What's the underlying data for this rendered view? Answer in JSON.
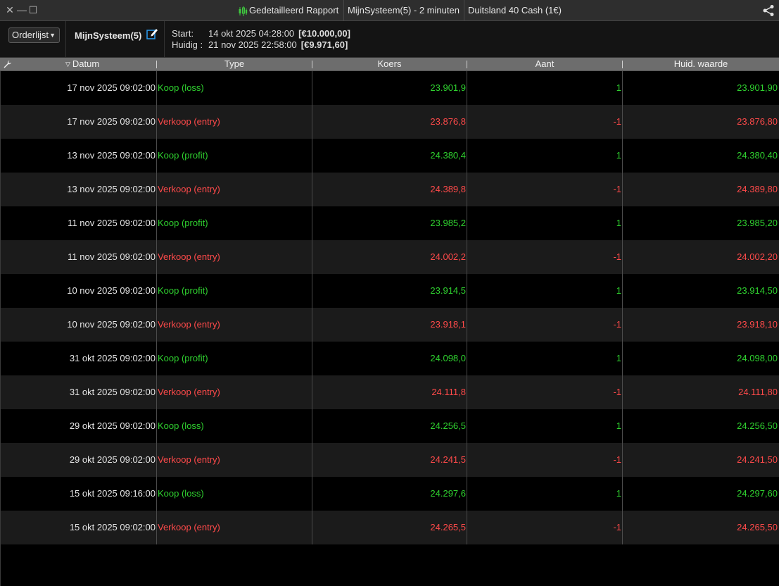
{
  "titlebar": {
    "report_label": "Gedetailleerd Rapport",
    "system_label": "MijnSysteem(5) - 2 minuten",
    "instrument_label": "Duitsland 40 Cash (1€)",
    "close_glyph": "✕",
    "minimize_glyph": "—",
    "maximize_glyph": "☐"
  },
  "toolbar": {
    "list_select": "Orderlijst",
    "system_name": "MijnSysteem(5)",
    "start_label": "Start:",
    "start_date": "14 okt 2025 04:28:00",
    "start_amount": "[€10.000,00]",
    "current_label": "Huidig :",
    "current_date": "21 nov 2025 22:58:00",
    "current_amount": "[€9.971,60]"
  },
  "table": {
    "headers": [
      "Datum",
      "Type",
      "Koers",
      "Aant",
      "Huid. waarde"
    ],
    "rows": [
      {
        "datum": "17 nov 2025 09:02:00",
        "type": "Koop (loss)",
        "koers": "23.901,9",
        "aant": "1",
        "waarde": "23.901,90",
        "side": "pos"
      },
      {
        "datum": "17 nov 2025 09:02:00",
        "type": "Verkoop (entry)",
        "koers": "23.876,8",
        "aant": "-1",
        "waarde": "23.876,80",
        "side": "neg"
      },
      {
        "datum": "13 nov 2025 09:02:00",
        "type": "Koop (profit)",
        "koers": "24.380,4",
        "aant": "1",
        "waarde": "24.380,40",
        "side": "pos"
      },
      {
        "datum": "13 nov 2025 09:02:00",
        "type": "Verkoop (entry)",
        "koers": "24.389,8",
        "aant": "-1",
        "waarde": "24.389,80",
        "side": "neg"
      },
      {
        "datum": "11 nov 2025 09:02:00",
        "type": "Koop (profit)",
        "koers": "23.985,2",
        "aant": "1",
        "waarde": "23.985,20",
        "side": "pos"
      },
      {
        "datum": "11 nov 2025 09:02:00",
        "type": "Verkoop (entry)",
        "koers": "24.002,2",
        "aant": "-1",
        "waarde": "24.002,20",
        "side": "neg"
      },
      {
        "datum": "10 nov 2025 09:02:00",
        "type": "Koop (profit)",
        "koers": "23.914,5",
        "aant": "1",
        "waarde": "23.914,50",
        "side": "pos"
      },
      {
        "datum": "10 nov 2025 09:02:00",
        "type": "Verkoop (entry)",
        "koers": "23.918,1",
        "aant": "-1",
        "waarde": "23.918,10",
        "side": "neg"
      },
      {
        "datum": "31 okt 2025 09:02:00",
        "type": "Koop (profit)",
        "koers": "24.098,0",
        "aant": "1",
        "waarde": "24.098,00",
        "side": "pos"
      },
      {
        "datum": "31 okt 2025 09:02:00",
        "type": "Verkoop (entry)",
        "koers": "24.111,8",
        "aant": "-1",
        "waarde": "24.111,80",
        "side": "neg"
      },
      {
        "datum": "29 okt 2025 09:02:00",
        "type": "Koop (loss)",
        "koers": "24.256,5",
        "aant": "1",
        "waarde": "24.256,50",
        "side": "pos"
      },
      {
        "datum": "29 okt 2025 09:02:00",
        "type": "Verkoop (entry)",
        "koers": "24.241,5",
        "aant": "-1",
        "waarde": "24.241,50",
        "side": "neg"
      },
      {
        "datum": "15 okt 2025 09:16:00",
        "type": "Koop (loss)",
        "koers": "24.297,6",
        "aant": "1",
        "waarde": "24.297,60",
        "side": "pos"
      },
      {
        "datum": "15 okt 2025 09:02:00",
        "type": "Verkoop (entry)",
        "koers": "24.265,5",
        "aant": "-1",
        "waarde": "24.265,50",
        "side": "neg"
      }
    ]
  },
  "colors": {
    "positive": "#2fd12f",
    "negative": "#ff4a4a",
    "header_bg": "#6d6d6d",
    "row_alt_bg": "#1b1b1b"
  },
  "icons": [
    "close-icon",
    "minimize-icon",
    "maximize-icon",
    "candlestick-chart-icon",
    "share-icon",
    "chevron-down-icon",
    "edit-icon",
    "wrench-icon",
    "sort-descending-icon"
  ]
}
